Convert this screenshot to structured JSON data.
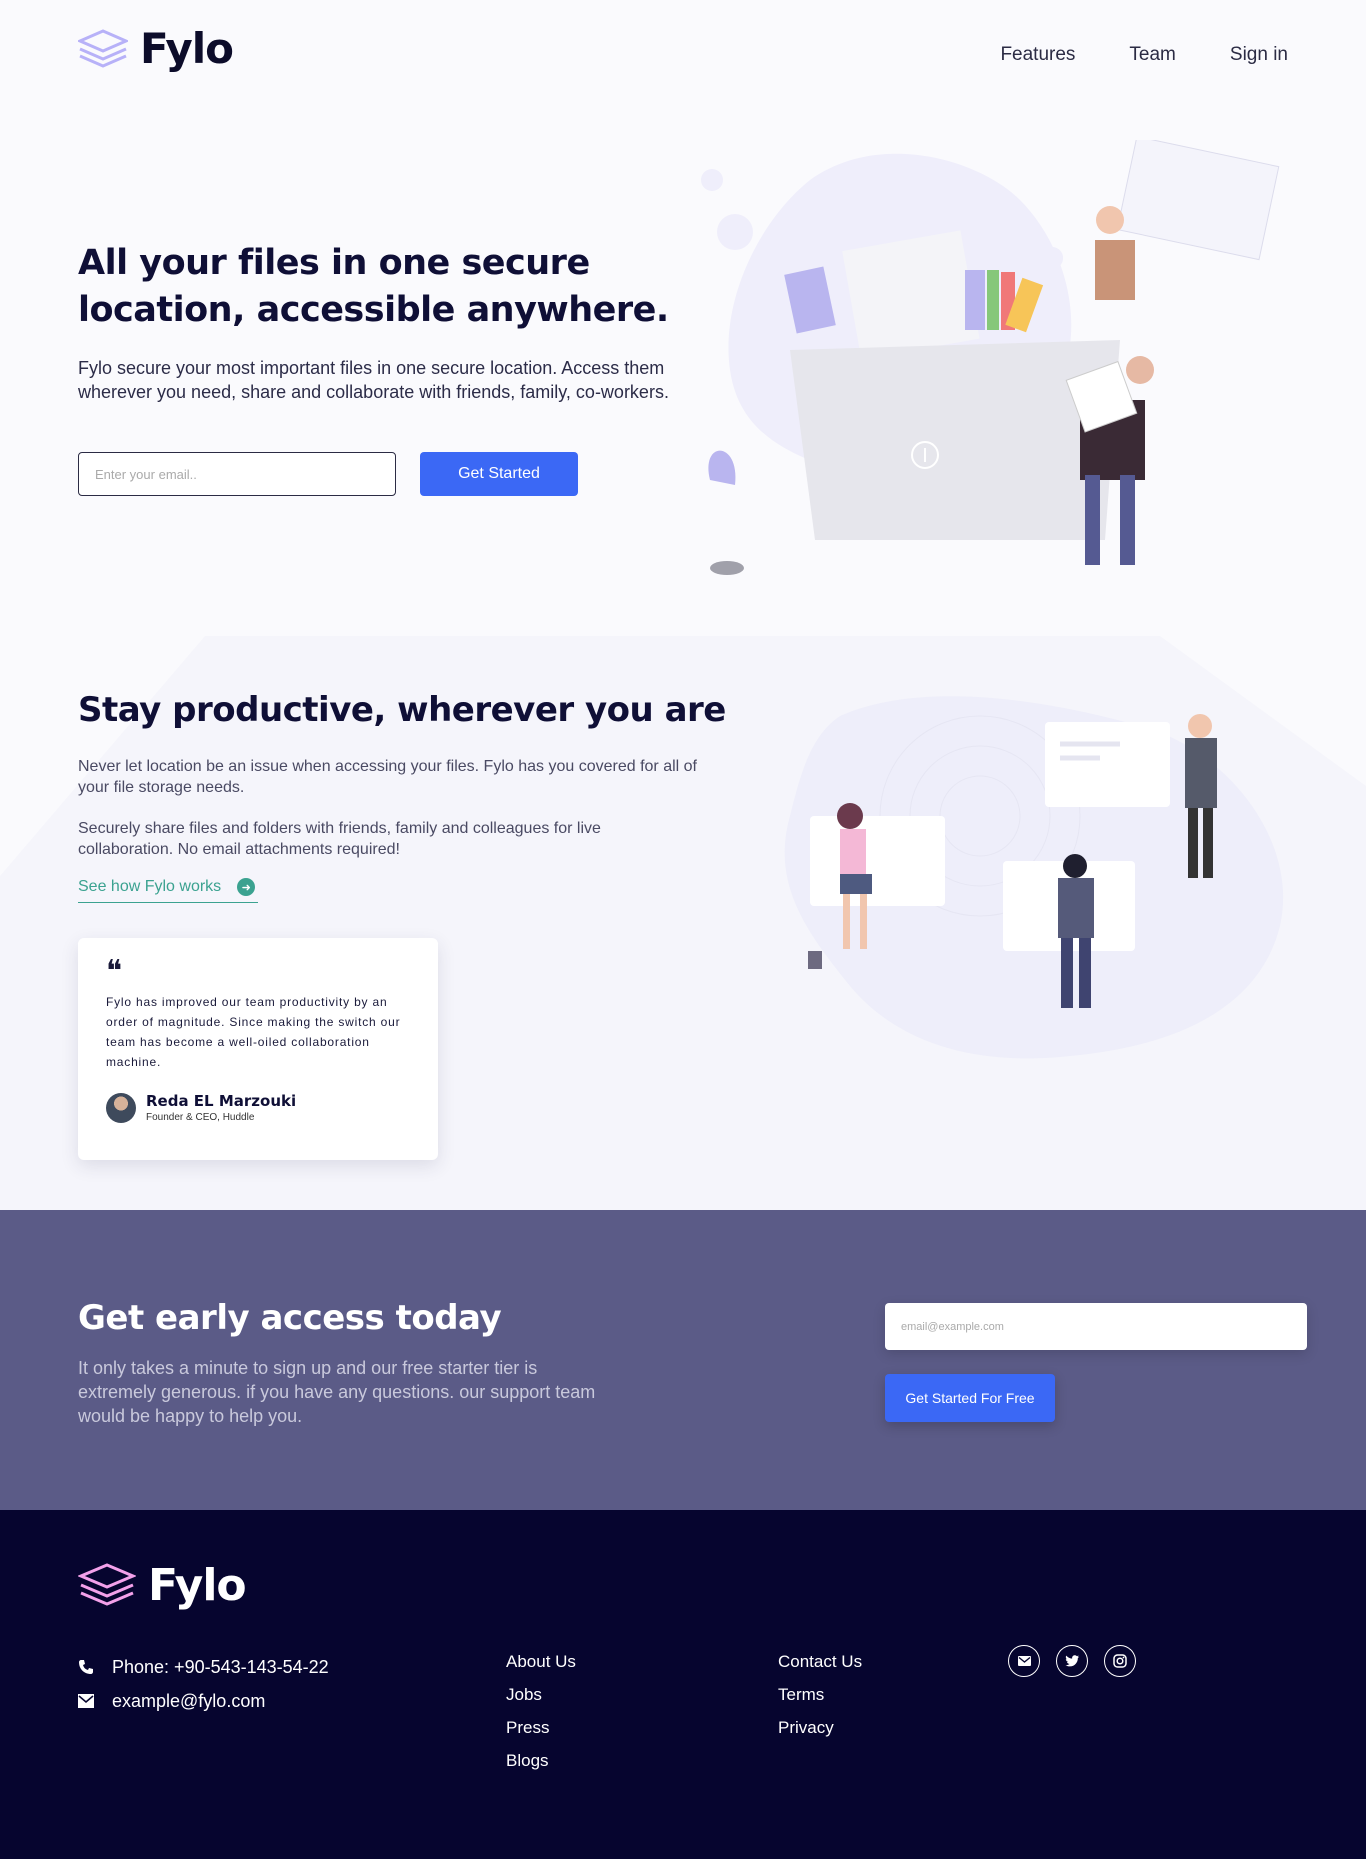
{
  "header": {
    "logo_text": "Fylo",
    "nav": [
      "Features",
      "Team",
      "Sign in"
    ]
  },
  "hero": {
    "title": "All your files in one secure location, accessible anywhere.",
    "description": "Fylo secure your most important files in one secure location. Access them wherever you need, share and collaborate with friends, family, co-workers.",
    "email_placeholder": "Enter your email..",
    "cta": "Get Started"
  },
  "productive": {
    "title": "Stay productive, wherever you are",
    "p1": "Never let location be an issue when accessing your files. Fylo has you covered for all of your file storage needs.",
    "p2": "Securely share files and folders with friends, family and colleagues for live collaboration. No email attachments required!",
    "link": "See how Fylo works",
    "testimonial": {
      "quote_mark": "❝",
      "text": "Fylo has improved our team productivity by an order of magnitude. Since making the switch our team has become a well-oiled collaboration machine.",
      "name": "Reda EL Marzouki",
      "role": "Founder & CEO, Huddle"
    }
  },
  "early_access": {
    "title": "Get early access today",
    "description": "It only takes a minute to sign up and our free starter tier is extremely generous. if you have any questions. our support team would be happy to help you.",
    "email_placeholder": "email@example.com",
    "cta": "Get Started For Free"
  },
  "footer": {
    "logo_text": "Fylo",
    "phone": "Phone: +90-543-143-54-22",
    "email": "example@fylo.com",
    "col1": [
      "About Us",
      "Jobs",
      "Press",
      "Blogs"
    ],
    "col2": [
      "Contact Us",
      "Terms",
      "Privacy"
    ],
    "socials": [
      "mail-icon",
      "twitter-icon",
      "instagram-icon"
    ]
  },
  "colors": {
    "accent_blue": "#3b68f5",
    "teal": "#3ba290",
    "early_bg": "#5b5b87",
    "footer_bg": "#06052f",
    "logo_purple": "#a29cf4",
    "logo_pink": "#f3a1ea"
  }
}
